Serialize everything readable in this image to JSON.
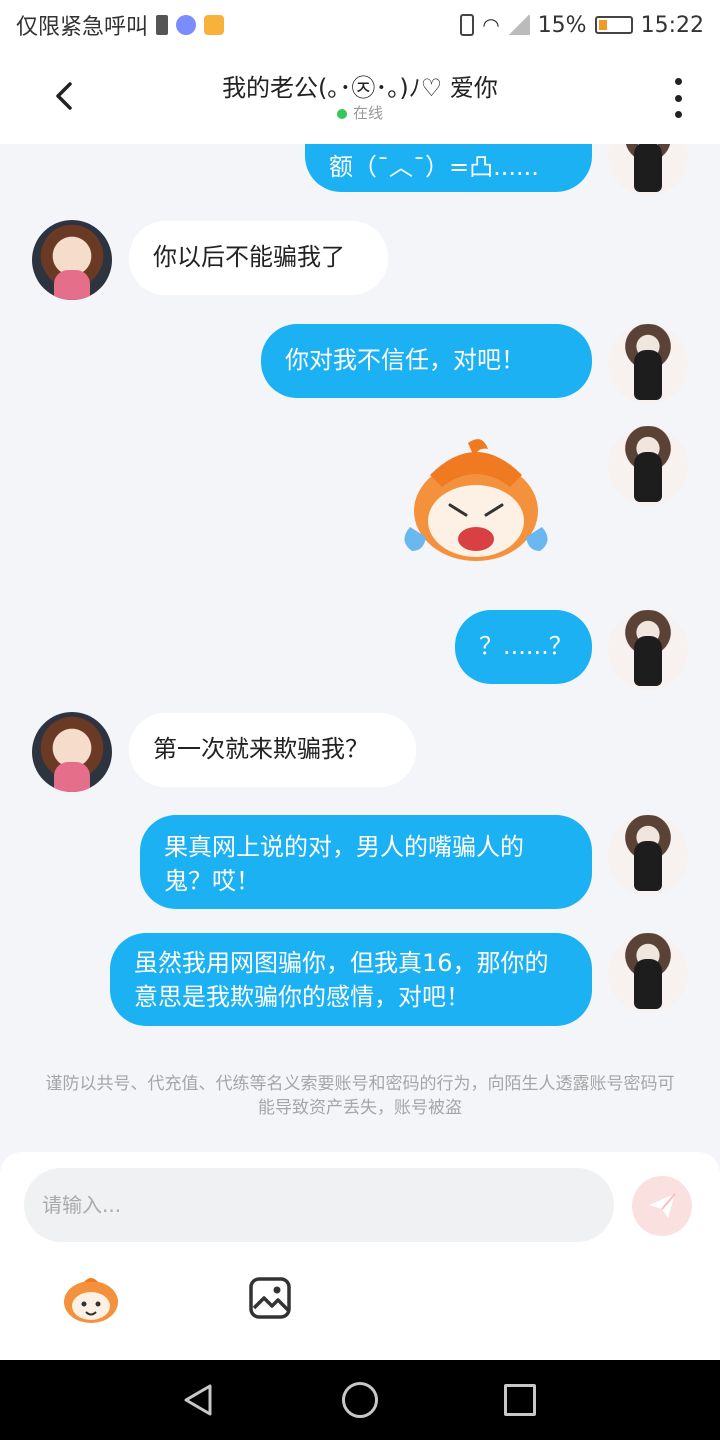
{
  "status_bar": {
    "carrier": "仅限紧急呼叫",
    "battery": "15%",
    "time": "15:22"
  },
  "header": {
    "back_icon": "chevron-left-icon",
    "title": "我的老公(｡･㉨･｡)ﾉ♡ 爱你",
    "status": "在线",
    "menu_icon": "more-vertical-icon"
  },
  "messages": [
    {
      "side": "right",
      "text": "额（¯︿¯）=凸......"
    },
    {
      "side": "left",
      "text": "你以后不能骗我了"
    },
    {
      "side": "right",
      "text": "你对我不信任，对吧！"
    },
    {
      "side": "right",
      "type": "sticker",
      "sticker": "crying-mascot-sticker"
    },
    {
      "side": "right",
      "text": "？......？"
    },
    {
      "side": "left",
      "text": "第一次就来欺骗我？"
    },
    {
      "side": "right",
      "text": "果真网上说的对，男人的嘴骗人的鬼？哎！"
    },
    {
      "side": "right",
      "text": "虽然我用网图骗你，但我真16，那你的意思是我欺骗你的感情，对吧！"
    }
  ],
  "warning": "谨防以共号、代充值、代练等名义索要账号和密码的行为，向陌生人透露账号密码可能导致资产丢失，账号被盗",
  "composer": {
    "placeholder": "请输入...",
    "send_icon": "paper-plane-icon",
    "emoji_icon": "mascot-emoji-icon",
    "image_icon": "image-icon"
  },
  "colors": {
    "accent": "#1bb1f3",
    "background": "#f3f5f9",
    "online": "#35c75a"
  }
}
